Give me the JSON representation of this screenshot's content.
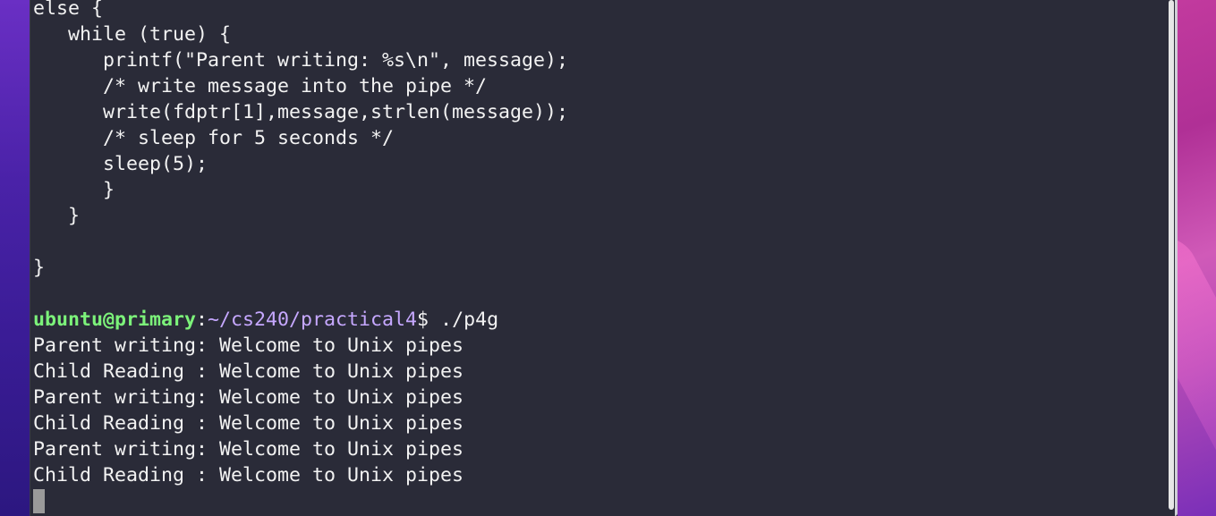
{
  "terminal": {
    "code_lines": [
      "else {",
      "   while (true) {",
      "      printf(\"Parent writing: %s\\n\", message);",
      "      /* write message into the pipe */",
      "      write(fdptr[1],message,strlen(message));",
      "      /* sleep for 5 seconds */",
      "      sleep(5);",
      "      }",
      "   }",
      "",
      "}",
      ""
    ],
    "prompt": {
      "user_host": "ubuntu@primary",
      "separator": ":",
      "path": "~/cs240/practical4",
      "symbol": "$ ",
      "command": "./p4g"
    },
    "output_lines": [
      "Parent writing: Welcome to Unix pipes",
      "Child Reading : Welcome to Unix pipes",
      "Parent writing: Welcome to Unix pipes",
      "Child Reading : Welcome to Unix pipes",
      "Parent writing: Welcome to Unix pipes",
      "Child Reading : Welcome to Unix pipes"
    ]
  },
  "colors": {
    "background": "#2a2b38",
    "text": "#f2f2f2",
    "prompt_user": "#7cf27a",
    "prompt_path": "#c6a8ff",
    "cursor": "#9a9a9a"
  }
}
